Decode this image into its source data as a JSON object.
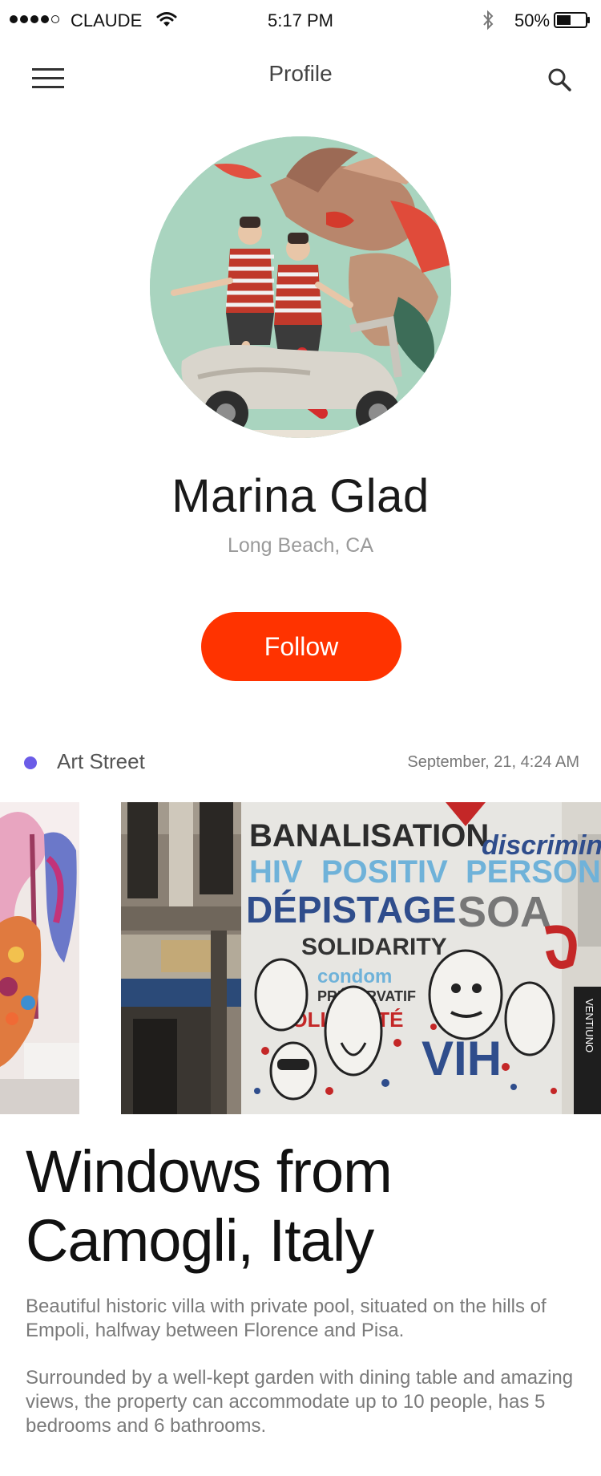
{
  "status_bar": {
    "carrier": "CLAUDE",
    "time": "5:17 PM",
    "battery": "50%",
    "battery_level": 0.5,
    "signal_bars_filled": 4,
    "signal_bars_total": 5
  },
  "nav": {
    "title": "Profile",
    "menu_icon": "hamburger-menu-icon",
    "search_icon": "search-icon"
  },
  "profile": {
    "name": "Marina Glad",
    "location": "Long Beach, CA",
    "follow_label": "Follow"
  },
  "post": {
    "category": "Art Street",
    "timestamp": "September, 21,  4:24 AM",
    "category_color": "#6b5ce7",
    "mural_words": [
      "BANALISATION",
      "discriminat",
      "HIV",
      "POSITIV",
      "PERSON",
      "DÉPISTAGE",
      "SOA",
      "SOLIDARITY",
      "condom",
      "PRÉSERVATIF",
      "SOLIDARITÉ",
      "VIH",
      "VENTIUNO"
    ],
    "title": "Windows from Camogli, Italy",
    "paragraphs": [
      "Beautiful historic villa with private pool, situated on the hills of Empoli, halfway between Florence and Pisa.",
      "Surrounded by a well-kept garden with dining table and amazing views, the property can accommodate up to 10 people, has 5 bedrooms and 6 bathrooms."
    ]
  },
  "colors": {
    "accent": "#ff3300",
    "category_dot": "#6b5ce7"
  }
}
